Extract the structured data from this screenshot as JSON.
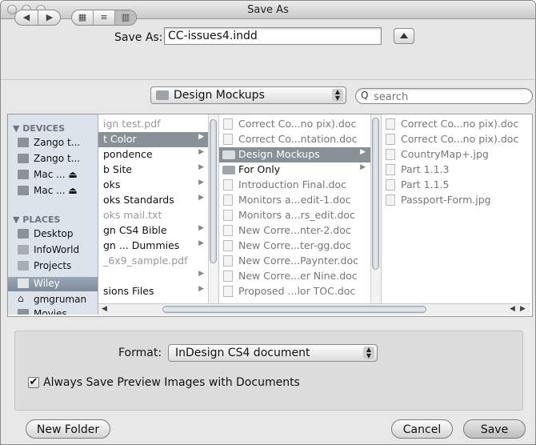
{
  "window": {
    "title": "Save As"
  },
  "save_as": {
    "label": "Save As:",
    "value": "CC-issues4.indd"
  },
  "toolbar": {
    "back_glyph": "◀",
    "forward_glyph": "▶",
    "icon_view_glyph": "▦",
    "list_view_glyph": "≡",
    "column_view_glyph": "▥",
    "location": "Design Mockups",
    "search_placeholder": "search"
  },
  "sidebar": {
    "devices_heading": "▼ DEVICES",
    "devices": [
      "Zango t...",
      "Zango t...",
      "Mac ... ⏏",
      "Mac ... ⏏"
    ],
    "places_heading": "▼ PLACES",
    "places": [
      "Desktop",
      "InfoWorld",
      "Projects",
      "Wiley",
      "gmgruman",
      "Movies"
    ]
  },
  "columns": {
    "col1": [
      "ign test.pdf",
      "t Color",
      "pondence",
      "b Site",
      "oks",
      "oks Standards",
      "oks mail.txt",
      "gn CS4 Bible",
      "gn ... Dummies",
      "_6x9_sample.pdf",
      "",
      "sions Files"
    ],
    "col2": [
      "Correct Co...no pix).doc",
      "Correct Co...ntation.doc",
      "Design Mockups",
      "For Only",
      "Introduction Final.doc",
      "Monitors a...edit-1.doc",
      "Monitors a...rs_edit.doc",
      "New Corre...nter-2.doc",
      "New Corre...ter-gg.doc",
      "New Corre...Paynter.doc",
      "New Corre...er Nine.doc",
      "Proposed ...lor TOC.doc"
    ],
    "col3": [
      "Correct Co...no pix).doc",
      "Correct Co...no pix).doc",
      "CountryMap+.jpg",
      "Part 1.1.3",
      "Part 1.1.5",
      "Passport-Form.jpg"
    ]
  },
  "format": {
    "label": "Format:",
    "value": "InDesign CS4 document"
  },
  "preview": {
    "label": "Always Save Preview Images with Documents",
    "checked": true
  },
  "buttons": {
    "new_folder": "New Folder",
    "cancel": "Cancel",
    "save": "Save"
  }
}
